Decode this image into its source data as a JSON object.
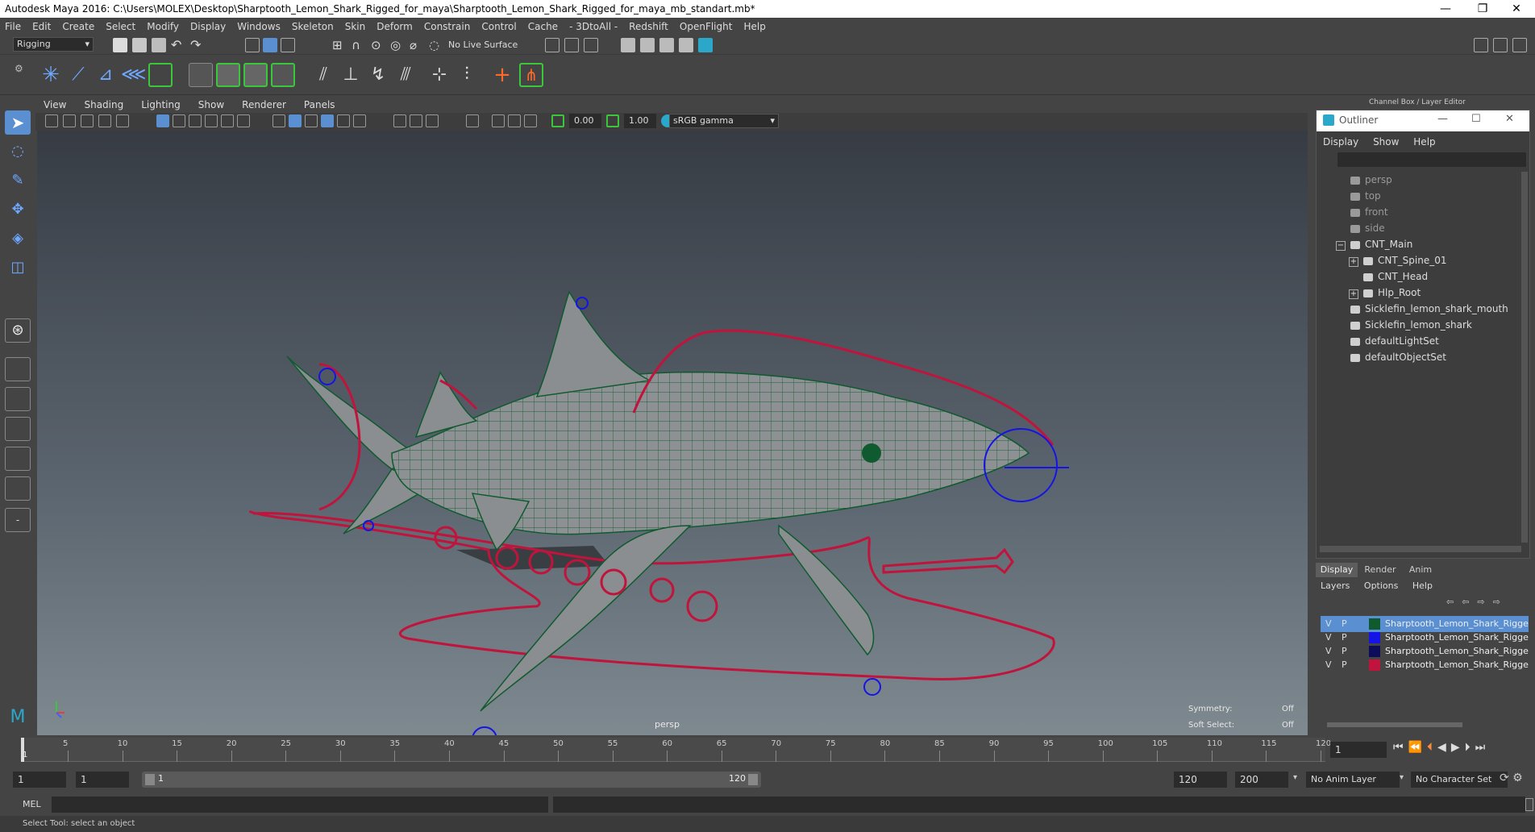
{
  "window": {
    "title": "Autodesk Maya 2016: C:\\Users\\MOLEX\\Desktop\\Sharptooth_Lemon_Shark_Rigged_for_maya\\Sharptooth_Lemon_Shark_Rigged_for_maya_mb_standart.mb*",
    "minimize": "—",
    "maximize": "❐",
    "close": "✕"
  },
  "menubar": [
    "File",
    "Edit",
    "Create",
    "Select",
    "Modify",
    "Display",
    "Windows",
    "Skeleton",
    "Skin",
    "Deform",
    "Constrain",
    "Control",
    "Cache",
    "- 3DtoAll -",
    "Redshift",
    "OpenFlight",
    "Help"
  ],
  "statusline": {
    "menuset": "Rigging",
    "live_surface": "No Live Surface"
  },
  "viewport": {
    "menu": [
      "View",
      "Shading",
      "Lighting",
      "Show",
      "Renderer",
      "Panels"
    ],
    "field1": "0.00",
    "field2": "1.00",
    "colorspace": "sRGB gamma",
    "camera_label": "persp",
    "symmetry_label": "Symmetry:",
    "symmetry_value": "Off",
    "softselect_label": "Soft Select:",
    "softselect_value": "Off"
  },
  "rightpanel": {
    "header": "Channel Box / Layer Editor"
  },
  "outliner": {
    "title": "Outliner",
    "menu": [
      "Display",
      "Show",
      "Help"
    ],
    "items": [
      {
        "label": "persp",
        "dim": true,
        "indent": 0,
        "expander": ""
      },
      {
        "label": "top",
        "dim": true,
        "indent": 0,
        "expander": ""
      },
      {
        "label": "front",
        "dim": true,
        "indent": 0,
        "expander": ""
      },
      {
        "label": "side",
        "dim": true,
        "indent": 0,
        "expander": ""
      },
      {
        "label": "CNT_Main",
        "dim": false,
        "indent": 0,
        "expander": "−"
      },
      {
        "label": "CNT_Spine_01",
        "dim": false,
        "indent": 1,
        "expander": "+"
      },
      {
        "label": "CNT_Head",
        "dim": false,
        "indent": 1,
        "expander": ""
      },
      {
        "label": "Hlp_Root",
        "dim": false,
        "indent": 1,
        "expander": "+"
      },
      {
        "label": "Sicklefin_lemon_shark_mouth",
        "dim": false,
        "indent": 0,
        "expander": ""
      },
      {
        "label": "Sicklefin_lemon_shark",
        "dim": false,
        "indent": 0,
        "expander": ""
      },
      {
        "label": "defaultLightSet",
        "dim": false,
        "indent": 0,
        "expander": ""
      },
      {
        "label": "defaultObjectSet",
        "dim": false,
        "indent": 0,
        "expander": ""
      }
    ]
  },
  "layers": {
    "tabs": [
      "Display",
      "Render",
      "Anim"
    ],
    "menu": [
      "Layers",
      "Options",
      "Help"
    ],
    "rows": [
      {
        "v": "V",
        "p": "P",
        "color": "#0f5a2e",
        "name": "Sharptooth_Lemon_Shark_Rigge",
        "selected": true
      },
      {
        "v": "V",
        "p": "P",
        "color": "#1414e6",
        "name": "Sharptooth_Lemon_Shark_Rigge",
        "selected": false
      },
      {
        "v": "V",
        "p": "P",
        "color": "#0c0c5a",
        "name": "Sharptooth_Lemon_Shark_Rigge",
        "selected": false
      },
      {
        "v": "V",
        "p": "P",
        "color": "#c0143c",
        "name": "Sharptooth_Lemon_Shark_Rigge",
        "selected": false
      }
    ]
  },
  "timeline": {
    "ticks": [
      "5",
      "10",
      "15",
      "20",
      "25",
      "30",
      "35",
      "40",
      "45",
      "50",
      "55",
      "60",
      "65",
      "70",
      "75",
      "80",
      "85",
      "90",
      "95",
      "100",
      "105",
      "110",
      "115",
      "120"
    ],
    "start_label": "1",
    "current_frame": "1"
  },
  "range": {
    "start": "1",
    "start2": "1",
    "slider_start": "1",
    "slider_end": "120",
    "end": "120",
    "end2": "200",
    "anim_layer": "No Anim Layer",
    "char_set": "No Character Set"
  },
  "cmdline": {
    "label": "MEL"
  },
  "helpline": "Select Tool: select an object",
  "colors": {
    "ui_bg": "#444444",
    "mesh_wire": "#0f5a2e",
    "control_red": "#c0143c",
    "joint_blue": "#1414e6",
    "selected_blue": "#5a8fd2"
  }
}
